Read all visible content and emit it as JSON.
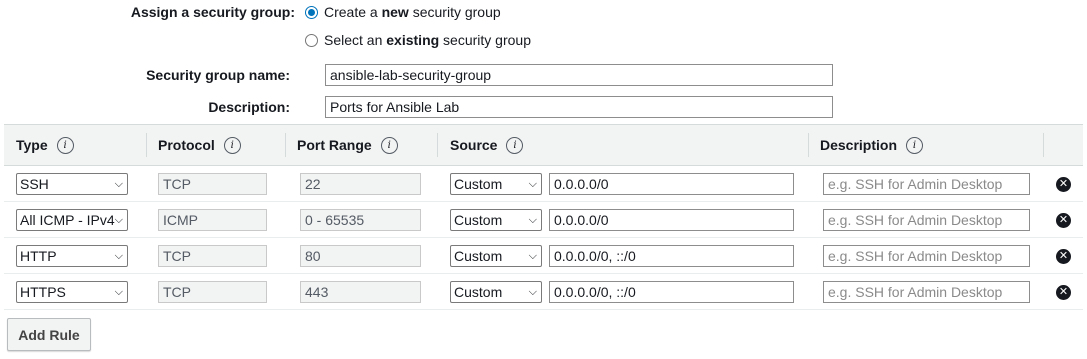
{
  "assign_group": {
    "label": "Assign a security group:",
    "option_new": {
      "pre": "Create a ",
      "bold": "new",
      "post": " security group",
      "checked": true
    },
    "option_existing": {
      "pre": "Select an ",
      "bold": "existing",
      "post": " security group",
      "checked": false
    }
  },
  "group_name": {
    "label": "Security group name:",
    "value": "ansible-lab-security-group"
  },
  "group_description": {
    "label": "Description:",
    "value": "Ports for Ansible Lab"
  },
  "table": {
    "headers": {
      "type": "Type",
      "protocol": "Protocol",
      "port_range": "Port Range",
      "source": "Source",
      "description": "Description",
      "info_glyph": "i"
    },
    "rows": [
      {
        "type": "SSH",
        "protocol": "TCP",
        "port_range": "22",
        "source_mode": "Custom",
        "source_value": "0.0.0.0/0",
        "description_placeholder": "e.g. SSH for Admin Desktop"
      },
      {
        "type": "All ICMP - IPv4",
        "protocol": "ICMP",
        "port_range": "0 - 65535",
        "source_mode": "Custom",
        "source_value": "0.0.0.0/0",
        "description_placeholder": "e.g. SSH for Admin Desktop"
      },
      {
        "type": "HTTP",
        "protocol": "TCP",
        "port_range": "80",
        "source_mode": "Custom",
        "source_value": "0.0.0.0/0, ::/0",
        "description_placeholder": "e.g. SSH for Admin Desktop"
      },
      {
        "type": "HTTPS",
        "protocol": "TCP",
        "port_range": "443",
        "source_mode": "Custom",
        "source_value": "0.0.0.0/0, ::/0",
        "description_placeholder": "e.g. SSH for Admin Desktop"
      }
    ]
  },
  "add_rule_label": "Add Rule",
  "icons": {
    "info": "info-icon",
    "remove": "remove-circle-icon",
    "dropdown": "chevron-down-icon"
  },
  "colors": {
    "accent": "#0073bb",
    "header_bg": "#f2f3f3"
  }
}
